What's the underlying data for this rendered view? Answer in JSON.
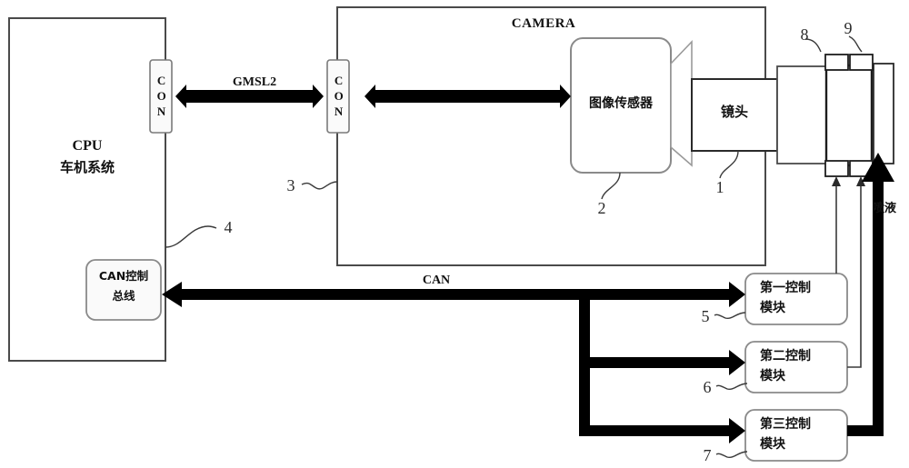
{
  "diagram": {
    "title_camera": "CAMERA",
    "cpu_block": {
      "line1": "CPU",
      "line2": "车机系统"
    },
    "connectors": {
      "left_con": "CON",
      "right_con": "CON"
    },
    "links": {
      "gmsl2": "GMSL2",
      "can": "CAN"
    },
    "camera_parts": {
      "image_sensor": "图像传感器",
      "lens": "镜头"
    },
    "can_bus_block": {
      "line1": "CAN控制",
      "line2": "总线"
    },
    "control_modules": [
      {
        "line1": "第一控制",
        "line2": "模块",
        "ref": "5"
      },
      {
        "line1": "第二控制",
        "line2": "模块",
        "ref": "6"
      },
      {
        "line1": "第三控制",
        "line2": "模块",
        "ref": "7"
      }
    ],
    "spray_label": "喷液",
    "ref_numbers": {
      "lens": "1",
      "image_sensor": "2",
      "camera_connector": "3",
      "can_bus": "4",
      "module_one": "5",
      "module_two": "6",
      "module_three": "7",
      "nozzle_left": "8",
      "nozzle_right": "9"
    },
    "colors": {
      "stroke_thin": "#4a4a4a",
      "stroke_box": "#222222",
      "arrow_fill": "#000000",
      "background": "#ffffff",
      "text": "#111111"
    }
  }
}
